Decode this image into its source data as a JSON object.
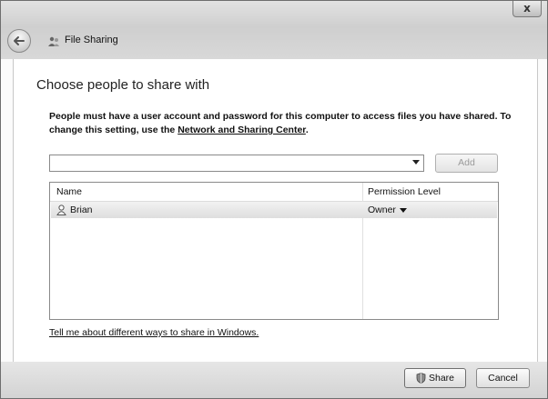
{
  "window": {
    "title": "File Sharing",
    "close_label": "x"
  },
  "main": {
    "heading": "Choose people to share with",
    "description_prefix": "People must have a user account and password for this computer to access files you have shared.  To change this setting, use the ",
    "description_link": "Network and Sharing Center",
    "description_suffix": ".",
    "user_combo_value": "",
    "add_button": "Add"
  },
  "table": {
    "columns": [
      "Name",
      "Permission Level"
    ],
    "rows": [
      {
        "name": "Brian",
        "permission": "Owner"
      }
    ]
  },
  "help_link": "Tell me about different ways to share in Windows.",
  "footer": {
    "share_button": "Share",
    "cancel_button": "Cancel"
  },
  "icons": {
    "back": "back-arrow-icon",
    "title": "file-sharing-icon",
    "user": "user-icon",
    "share": "shield-icon"
  }
}
